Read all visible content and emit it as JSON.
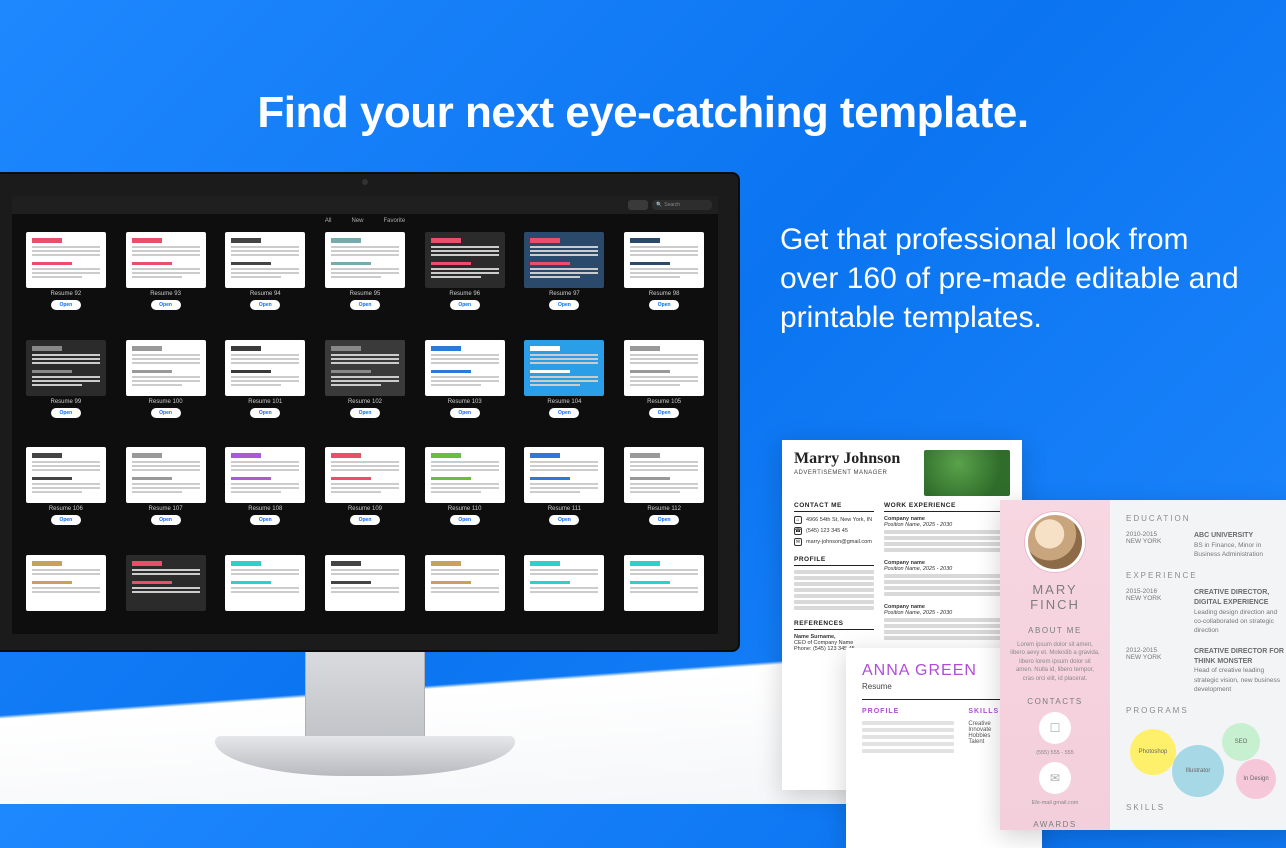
{
  "hero": {
    "title": "Find your next eye-catching template.",
    "subtitle": "Get that professional look from over 160 of pre-made editable and printable templates."
  },
  "app": {
    "tabs": [
      "All",
      "New",
      "Favorite"
    ],
    "search_placeholder": "Search",
    "open_label": "Open",
    "templates": [
      {
        "label": "Resume 92"
      },
      {
        "label": "Resume 93"
      },
      {
        "label": "Resume 94"
      },
      {
        "label": "Resume 95"
      },
      {
        "label": "Resume 96"
      },
      {
        "label": "Resume 97"
      },
      {
        "label": "Resume 98"
      },
      {
        "label": "Resume 99"
      },
      {
        "label": "Resume 100"
      },
      {
        "label": "Resume 101"
      },
      {
        "label": "Resume 102"
      },
      {
        "label": "Resume 103"
      },
      {
        "label": "Resume 104"
      },
      {
        "label": "Resume 105"
      },
      {
        "label": "Resume 106"
      },
      {
        "label": "Resume 107"
      },
      {
        "label": "Resume 108"
      },
      {
        "label": "Resume 109"
      },
      {
        "label": "Resume 110"
      },
      {
        "label": "Resume 111"
      },
      {
        "label": "Resume 112"
      }
    ]
  },
  "preview": {
    "doc1": {
      "name": "Marry Johnson",
      "role": "ADVERTISEMENT MANAGER",
      "sections": {
        "contact": "CONTACT ME",
        "profile": "PROFILE",
        "work": "WORK EXPERIENCE",
        "references": "REFERENCES"
      },
      "address": "4966 54th St, New York, IN",
      "phone": "(545) 123 345 45",
      "email": "marry-johnson@gmail.com",
      "work_company": "Company name",
      "work_dates": "Position Name, 2025 - 2030"
    },
    "doc2": {
      "name": "ANNA GREEN",
      "sub": "Resume",
      "profile_hd": "PROFILE",
      "skills_hd": "SKILLS",
      "skills": [
        "Creative",
        "Innovate",
        "Hobbies",
        "Talent"
      ]
    },
    "doc3": {
      "name": "MARY FINCH",
      "about_hd": "ABOUT ME",
      "about_text": "Lorem ipsum dolor sit amen, libero aevy et. Molestib a gravida, libero lorem ipsum dolor sit amen. Nulla id, libero tempor, cras orci elit, id placerat.",
      "contacts_hd": "CONTACTS",
      "phone": "(555) 555 - 555",
      "email": "Efe-mail gmail.com",
      "awards_hd": "AWARDS",
      "education_hd": "EDUCATION",
      "education": [
        {
          "years": "2010-2015",
          "city": "NEW YORK",
          "title": "ABC UNIVERSITY",
          "detail": "BS in Finance, Minor in Business Administration"
        }
      ],
      "experience_hd": "EXPERIENCE",
      "experience": [
        {
          "years": "2015-2016",
          "city": "NEW YORK",
          "title": "CREATIVE DIRECTOR, DIGITAL EXPERIENCE",
          "detail": "Leading design direction and co-collaborated on strategic direction"
        },
        {
          "years": "2012-2015",
          "city": "NEW YORK",
          "title": "CREATIVE DIRECTOR FOR THINK MONSTER",
          "detail": "Head of creative leading strategic vision, new business development"
        }
      ],
      "programs_hd": "PROGRAMS",
      "bubbles": [
        "Photoshop",
        "Illustrator",
        "SEO",
        "In Design"
      ],
      "skills_hd": "SKILLS"
    }
  }
}
